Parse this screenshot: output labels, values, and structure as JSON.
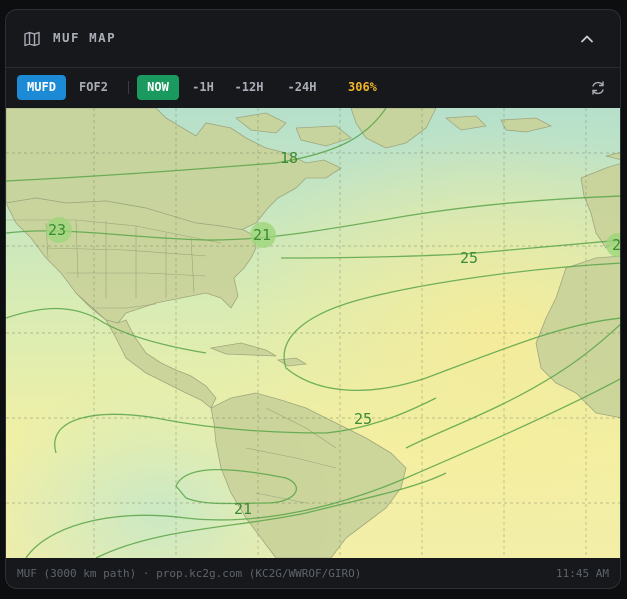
{
  "header": {
    "title": "MUF MAP",
    "map_icon": "map-icon",
    "collapse_icon": "chevron-up-icon"
  },
  "toolbar": {
    "layer_mufd": "MUFD",
    "layer_fof2": "FOF2",
    "time_now": "NOW",
    "time_1h": "-1H",
    "time_12h": "-12H",
    "time_24h": "-24H",
    "zoom": "306%",
    "refresh_icon": "refresh-icon"
  },
  "map": {
    "contour_labels": [
      "18",
      "23",
      "21",
      "25",
      "25",
      "21",
      "2"
    ],
    "colors": {
      "ocean_cool": "#b9e0c8",
      "ocean_warm": "#f4f0a6",
      "land": "#cdd29a",
      "contour": "#5aa54a",
      "label": "#3d8a34"
    }
  },
  "footer": {
    "source": "MUF (3000 km path) · prop.kc2g.com (KC2G/WWROF/GIRO)",
    "time": "11:45 AM"
  }
}
